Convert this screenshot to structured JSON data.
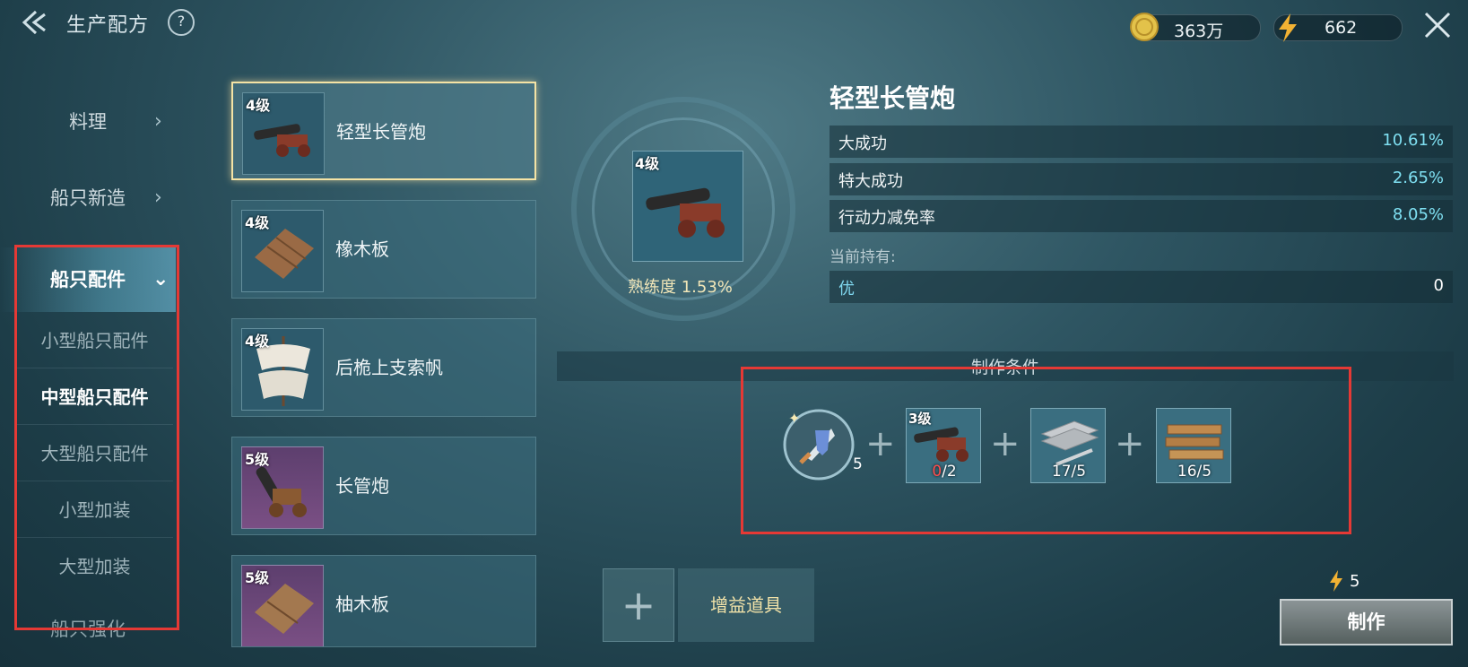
{
  "header": {
    "title": "生产配方",
    "help": "?",
    "gold": "363万",
    "energy": "662",
    "icons": {
      "back": "back-arrow-icon",
      "gold": "coin-icon",
      "energy": "lightning-icon",
      "close": "close-icon"
    }
  },
  "menu": {
    "items": [
      {
        "label": "料理"
      },
      {
        "label": "船只新造"
      },
      {
        "label": "船只配件"
      },
      {
        "label": "船只强化"
      }
    ],
    "sub_items": [
      {
        "label": "小型船只配件"
      },
      {
        "label": "中型船只配件"
      },
      {
        "label": "大型船只配件"
      },
      {
        "label": "小型加装"
      },
      {
        "label": "大型加装"
      }
    ],
    "active": "船只配件",
    "active_sub": "中型船只配件"
  },
  "recipes": [
    {
      "level": "4级",
      "name": "轻型长管炮",
      "icon": "cannon-icon",
      "selected": true
    },
    {
      "level": "4级",
      "name": "橡木板",
      "icon": "wood-plank-icon"
    },
    {
      "level": "4级",
      "name": "后桅上支索帆",
      "icon": "sail-icon"
    },
    {
      "level": "5级",
      "name": "长管炮",
      "icon": "cannon-icon"
    },
    {
      "level": "5级",
      "name": "柚木板",
      "icon": "wood-plank-icon"
    }
  ],
  "preview": {
    "level": "4级",
    "proficiency": "熟练度 1.53%"
  },
  "detail": {
    "title": "轻型长管炮",
    "stats": [
      {
        "label": "大成功",
        "value": "10.61%"
      },
      {
        "label": "特大成功",
        "value": "2.65%"
      },
      {
        "label": "行动力减免率",
        "value": "8.05%"
      }
    ],
    "holding_label": "当前持有:",
    "holding": {
      "label": "优",
      "value": "0"
    },
    "condition_label": "制作条件"
  },
  "materials": [
    {
      "icon": "crafting-skill-icon",
      "count": "5"
    },
    {
      "icon": "cannon-icon",
      "level": "3级",
      "have": "0",
      "need": "/2",
      "have_color": "#ff4d4d"
    },
    {
      "icon": "metal-plate-icon",
      "count": "17/5"
    },
    {
      "icon": "lumber-icon",
      "count": "16/5"
    }
  ],
  "bottom": {
    "boost_label": "增益道具",
    "add_symbol": "+",
    "cost": "5",
    "make_label": "制作"
  }
}
